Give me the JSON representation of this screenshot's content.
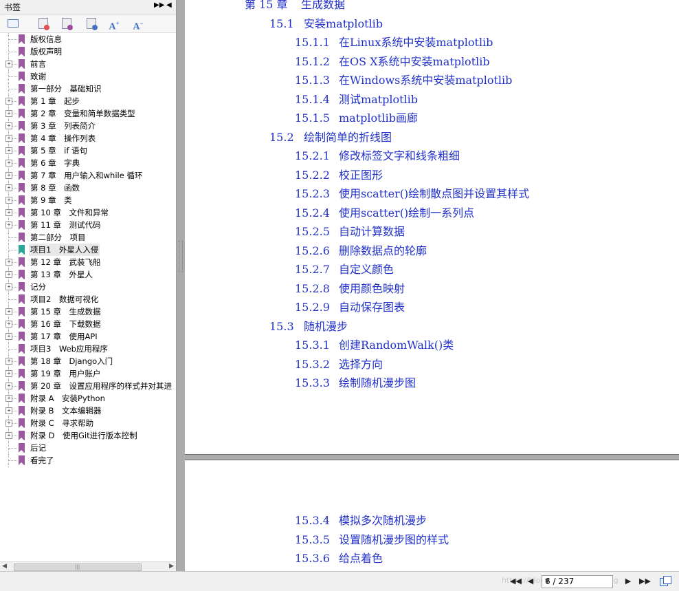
{
  "sidebar": {
    "title": "书签",
    "bookmarks": [
      {
        "label": "版权信息",
        "expandable": false
      },
      {
        "label": "版权声明",
        "expandable": false
      },
      {
        "label": "前言",
        "expandable": true
      },
      {
        "label": "致谢",
        "expandable": false
      },
      {
        "label": "第一部分　基础知识",
        "expandable": false
      },
      {
        "label": "第 1 章　起步",
        "expandable": true
      },
      {
        "label": "第 2 章　变量和简单数据类型",
        "expandable": true
      },
      {
        "label": "第 3 章　列表简介",
        "expandable": true
      },
      {
        "label": "第 4 章　操作列表",
        "expandable": true
      },
      {
        "label": "第 5 章　if 语句",
        "expandable": true
      },
      {
        "label": "第 6 章　字典",
        "expandable": true
      },
      {
        "label": "第 7 章　用户输入和while 循环",
        "expandable": true
      },
      {
        "label": "第 8 章　函数",
        "expandable": true
      },
      {
        "label": "第 9 章　类",
        "expandable": true
      },
      {
        "label": "第 10 章　文件和异常",
        "expandable": true
      },
      {
        "label": "第 11 章　测试代码",
        "expandable": true
      },
      {
        "label": "第二部分　项目",
        "expandable": false
      },
      {
        "label": "项目1　外星人入侵",
        "expandable": false,
        "selected": true
      },
      {
        "label": "第 12 章　武装飞船",
        "expandable": true
      },
      {
        "label": "第 13 章　外星人",
        "expandable": true
      },
      {
        "label": "记分",
        "expandable": true
      },
      {
        "label": "项目2　数据可视化",
        "expandable": false
      },
      {
        "label": "第 15 章　生成数据",
        "expandable": true
      },
      {
        "label": "第 16 章　下载数据",
        "expandable": true
      },
      {
        "label": "第 17 章　使用API",
        "expandable": true
      },
      {
        "label": "项目3　Web应用程序",
        "expandable": false
      },
      {
        "label": "第 18 章　Django入门",
        "expandable": true
      },
      {
        "label": "第 19 章　用户账户",
        "expandable": true
      },
      {
        "label": "第 20 章　设置应用程序的样式并对其进",
        "expandable": true
      },
      {
        "label": "附录 A　安装Python",
        "expandable": true
      },
      {
        "label": "附录 B　文本编辑器",
        "expandable": true
      },
      {
        "label": "附录 C　寻求帮助",
        "expandable": true
      },
      {
        "label": "附录 D　使用Git进行版本控制",
        "expandable": true
      },
      {
        "label": "后记",
        "expandable": false
      },
      {
        "label": "看完了",
        "expandable": false
      }
    ]
  },
  "page1": {
    "entries": [
      {
        "level": 0,
        "num": "第 15 章",
        "title": "生成数据"
      },
      {
        "level": 1,
        "num": "15.1",
        "title": "安装matplotlib"
      },
      {
        "level": 2,
        "num": "15.1.1",
        "title": "在Linux系统中安装matplotlib"
      },
      {
        "level": 2,
        "num": "15.1.2",
        "title": "在OS X系统中安装matplotlib"
      },
      {
        "level": 2,
        "num": "15.1.3",
        "title": "在Windows系统中安装matplotlib"
      },
      {
        "level": 2,
        "num": "15.1.4",
        "title": "测试matplotlib"
      },
      {
        "level": 2,
        "num": "15.1.5",
        "title": "matplotlib画廊"
      },
      {
        "level": 1,
        "num": "15.2",
        "title": "绘制简单的折线图"
      },
      {
        "level": 2,
        "num": "15.2.1",
        "title": "修改标签文字和线条粗细"
      },
      {
        "level": 2,
        "num": "15.2.2",
        "title": "校正图形"
      },
      {
        "level": 2,
        "num": "15.2.3",
        "title": "使用scatter()绘制散点图并设置其样式"
      },
      {
        "level": 2,
        "num": "15.2.4",
        "title": "使用scatter()绘制一系列点"
      },
      {
        "level": 2,
        "num": "15.2.5",
        "title": "自动计算数据"
      },
      {
        "level": 2,
        "num": "15.2.6",
        "title": "删除数据点的轮廓"
      },
      {
        "level": 2,
        "num": "15.2.7",
        "title": "自定义颜色"
      },
      {
        "level": 2,
        "num": "15.2.8",
        "title": "使用颜色映射"
      },
      {
        "level": 2,
        "num": "15.2.9",
        "title": "自动保存图表"
      },
      {
        "level": 1,
        "num": "15.3",
        "title": "随机漫步"
      },
      {
        "level": 2,
        "num": "15.3.1",
        "title": "创建RandomWalk()类"
      },
      {
        "level": 2,
        "num": "15.3.2",
        "title": "选择方向"
      },
      {
        "level": 2,
        "num": "15.3.3",
        "title": "绘制随机漫步图"
      }
    ]
  },
  "page2": {
    "entries": [
      {
        "level": 2,
        "num": "15.3.4",
        "title": "模拟多次随机漫步"
      },
      {
        "level": 2,
        "num": "15.3.5",
        "title": "设置随机漫步图的样式"
      },
      {
        "level": 2,
        "num": "15.3.6",
        "title": "给点着色"
      }
    ]
  },
  "statusbar": {
    "page_indicator": "6 / 237",
    "watermark": "https://blog.csdn.net/Ant_hong"
  },
  "colors": {
    "toc_link": "#2030c8",
    "bookmark_icon": "#9b5aa0",
    "bookmark_icon_selected": "#2aa89a"
  }
}
